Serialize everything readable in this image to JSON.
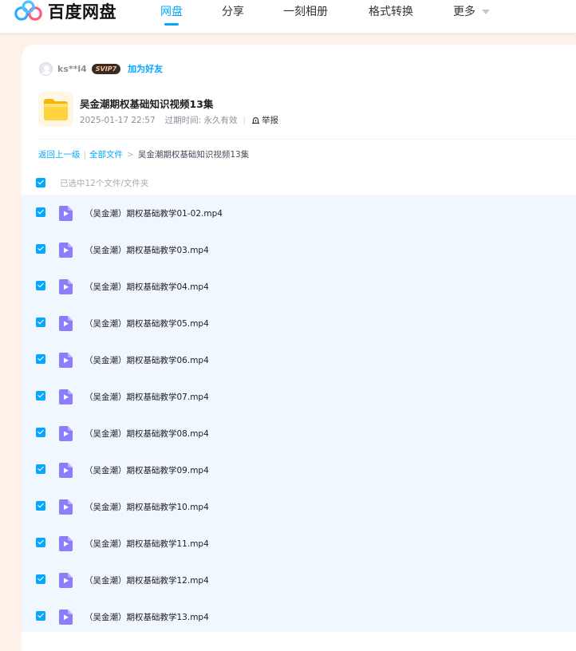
{
  "header": {
    "logo_text": "百度网盘",
    "nav": [
      {
        "label": "网盘",
        "active": true
      },
      {
        "label": "分享",
        "active": false
      },
      {
        "label": "一刻相册",
        "active": false
      },
      {
        "label": "格式转换",
        "active": false
      },
      {
        "label": "更多",
        "active": false
      }
    ],
    "accent_color": "#06a7ff"
  },
  "share": {
    "username": "ks**l4",
    "vip_badge": "SVIP7",
    "add_friend": "加为好友",
    "title": "吴金潮期权基础知识视频13集",
    "date": "2025-01-17 22:57",
    "expiry_label": "过期时间: 永久有效",
    "report": "举报"
  },
  "breadcrumb": {
    "back": "返回上一级",
    "all_files": "全部文件",
    "separator": ">",
    "current": "吴金潮期权基础知识视频13集"
  },
  "selection": {
    "text": "已选中12个文件/文件夹",
    "all_checked": true
  },
  "files": [
    {
      "name": "（吴金潮）期权基础教学01-02.mp4",
      "checked": true
    },
    {
      "name": "（吴金潮）期权基础教学03.mp4",
      "checked": true
    },
    {
      "name": "（吴金潮）期权基础教学04.mp4",
      "checked": true
    },
    {
      "name": "（吴金潮）期权基础教学05.mp4",
      "checked": true
    },
    {
      "name": "（吴金潮）期权基础教学06.mp4",
      "checked": true
    },
    {
      "name": "（吴金潮）期权基础教学07.mp4",
      "checked": true
    },
    {
      "name": "（吴金潮）期权基础教学08.mp4",
      "checked": true
    },
    {
      "name": "（吴金潮）期权基础教学09.mp4",
      "checked": true
    },
    {
      "name": "（吴金潮）期权基础教学10.mp4",
      "checked": true
    },
    {
      "name": "（吴金潮）期权基础教学11.mp4",
      "checked": true
    },
    {
      "name": "（吴金潮）期权基础教学12.mp4",
      "checked": true
    },
    {
      "name": "（吴金潮）期权基础教学13.mp4",
      "checked": true
    }
  ]
}
